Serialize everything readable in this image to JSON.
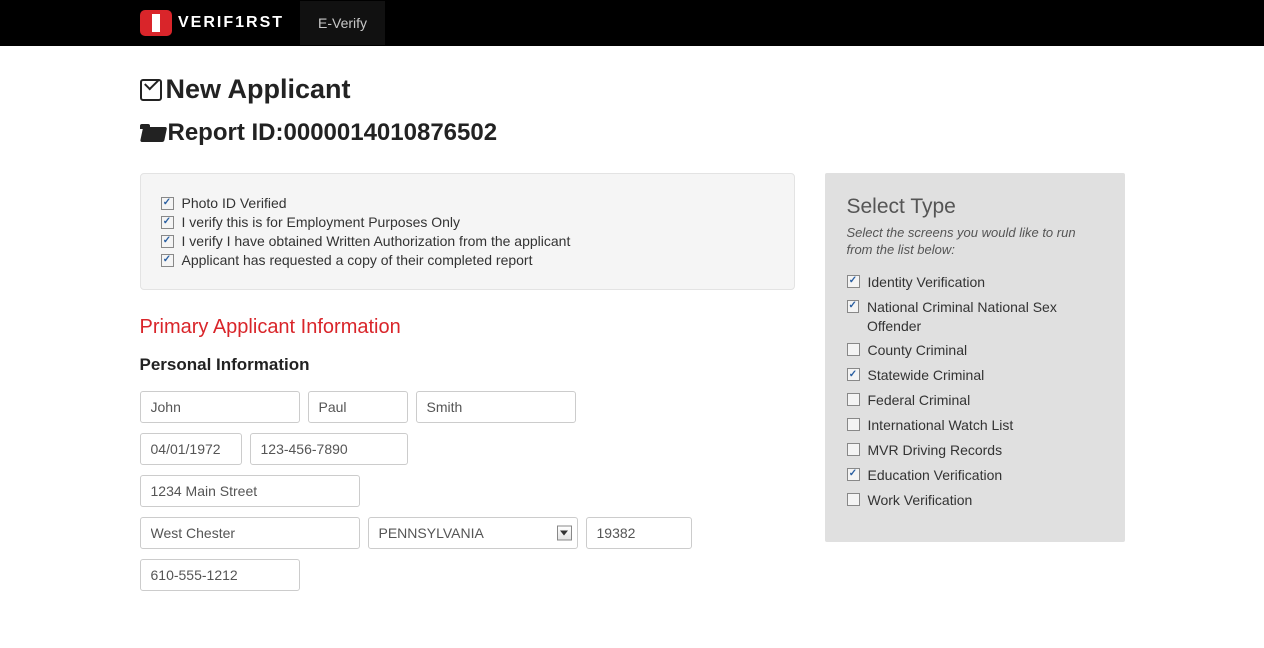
{
  "header": {
    "brand": "VERIF1RST",
    "nav_tab": "E-Verify"
  },
  "page": {
    "title": "New Applicant",
    "report_label": "Report ID: ",
    "report_id": "0000014010876502"
  },
  "verify_box": {
    "items": [
      {
        "label": "Photo ID Verified",
        "checked": true
      },
      {
        "label": "I verify this is for Employment Purposes Only",
        "checked": true
      },
      {
        "label": "I verify I have obtained Written Authorization from the applicant",
        "checked": true
      },
      {
        "label": "Applicant has requested a copy of their completed report",
        "checked": true
      }
    ]
  },
  "sections": {
    "primary_title": "Primary Applicant Information",
    "personal_title": "Personal Information"
  },
  "applicant": {
    "first_name": "John",
    "middle_name": "Paul",
    "last_name": "Smith",
    "dob": "04/01/1972",
    "ssn": "123-456-7890",
    "street": "1234 Main Street",
    "city": "West Chester",
    "state": "PENNSYLVANIA",
    "zip": "19382",
    "phone": "610-555-1212"
  },
  "side": {
    "title": "Select Type",
    "hint": "Select the screens you would like to run from the list below:",
    "options": [
      {
        "label": "Identity Verification",
        "checked": true
      },
      {
        "label": "National Criminal National Sex Offender",
        "checked": true
      },
      {
        "label": "County Criminal",
        "checked": false
      },
      {
        "label": "Statewide Criminal",
        "checked": true
      },
      {
        "label": "Federal Criminal",
        "checked": false
      },
      {
        "label": "International Watch List",
        "checked": false
      },
      {
        "label": "MVR Driving Records",
        "checked": false
      },
      {
        "label": "Education Verification",
        "checked": true
      },
      {
        "label": "Work Verification",
        "checked": false
      }
    ]
  }
}
